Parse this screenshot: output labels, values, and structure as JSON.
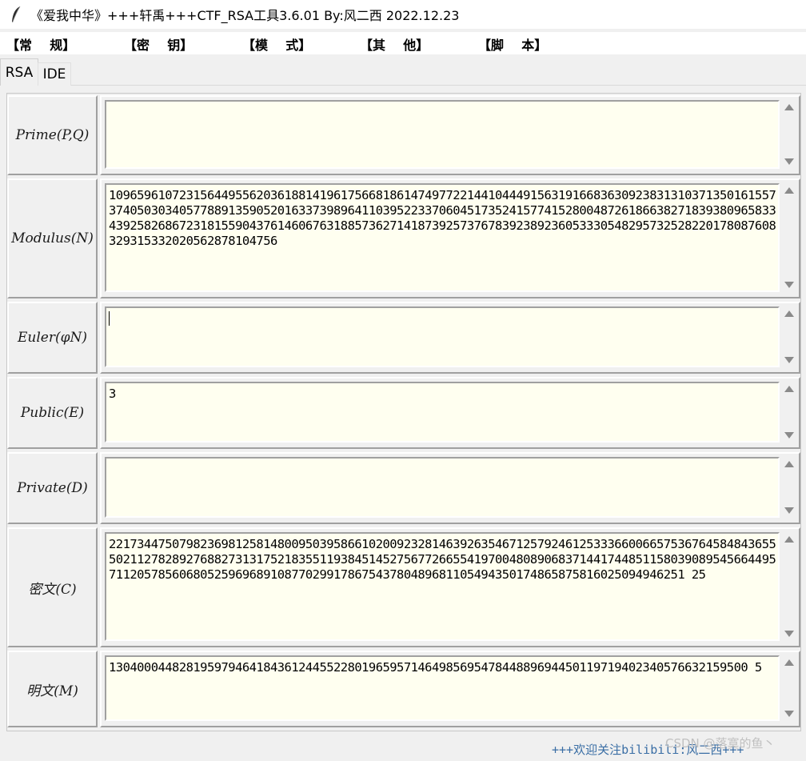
{
  "window": {
    "title": "《爱我中华》+++轩禹+++CTF_RSA工具3.6.01    By:风二西 2022.12.23",
    "icon": "feather-icon"
  },
  "menu": {
    "items": [
      {
        "label": "【常    规】"
      },
      {
        "label": "【密    钥】"
      },
      {
        "label": "【模    式】"
      },
      {
        "label": "【其    他】"
      },
      {
        "label": "【脚    本】"
      }
    ]
  },
  "tabs": [
    {
      "label": "RSA",
      "active": true
    },
    {
      "label": "IDE",
      "active": false
    }
  ],
  "fields": {
    "prime": {
      "label": "Prime(P,Q)",
      "value": ""
    },
    "modulus": {
      "label": "Modulus(N)",
      "value": "109659610723156449556203618814196175668186147497722144104449156319166836309238313103713501615573740503034057788913590520163373989641103952233706045173524157741528004872618663827183938096583343925826867231815590437614606763188573627141873925737678392389236053330548295732528220178087608329315332020562878104756"
    },
    "euler": {
      "label": "Euler(φN)",
      "value": ""
    },
    "public": {
      "label": "Public(E)",
      "value": "3"
    },
    "private": {
      "label": "Private(D)",
      "value": ""
    },
    "ciphertext": {
      "label": "密文(C)",
      "value": "22173447507982369812581480095039586610200923281463926354671257924612533366006657536764584843655502112782892768827313175218355119384514527567726655419700480890683714417448511580390895456644957112057856068052596968910877029917867543780489681105494350174865875816025094946251 25"
    },
    "plaintext": {
      "label": "明文(M)",
      "value": "1304000448281959794641843612445522801965957146498569547844889694450119719402340576632159500 5"
    }
  },
  "footer": {
    "text": "+++欢迎关注bilibili:风二西+++",
    "watermark": "CSDN @落寞的鱼丶"
  }
}
